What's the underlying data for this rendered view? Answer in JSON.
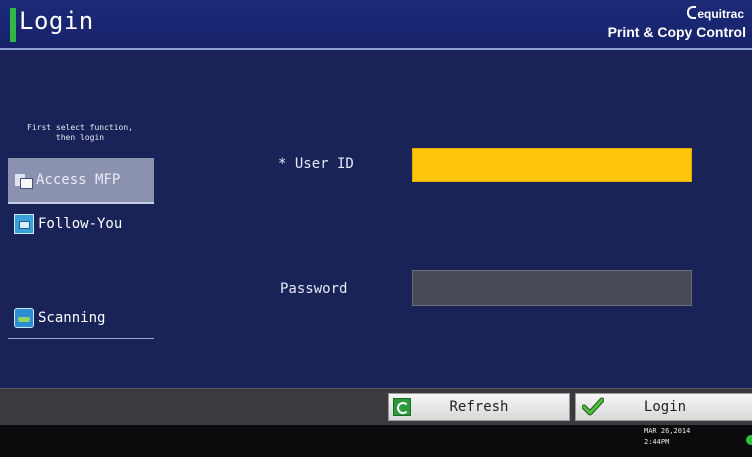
{
  "header": {
    "title": "Login",
    "brand_logo": "equitrac",
    "brand_name": "Print & Copy Control"
  },
  "sidebar": {
    "caption_line1": "First select function,",
    "caption_line2": "then login",
    "items": [
      {
        "label": "Access MFP",
        "icon": "access-mfp-icon",
        "selected": true
      },
      {
        "label": "Follow-You",
        "icon": "follow-you-icon",
        "selected": false
      },
      {
        "label": "Scanning",
        "icon": "scanning-icon",
        "selected": false
      }
    ]
  },
  "form": {
    "userid_label": "* User ID",
    "userid_value": "",
    "password_label": "Password",
    "password_value": ""
  },
  "buttons": {
    "refresh_label": "Refresh",
    "login_label": "Login"
  },
  "status": {
    "date": "MAR  26,2014",
    "time": "2:44PM"
  },
  "colors": {
    "background": "#1a2358",
    "header": "#1c2a78",
    "userid_field": "#ffc60a",
    "password_field": "#484b57",
    "title_accent": "#2fb84a"
  }
}
